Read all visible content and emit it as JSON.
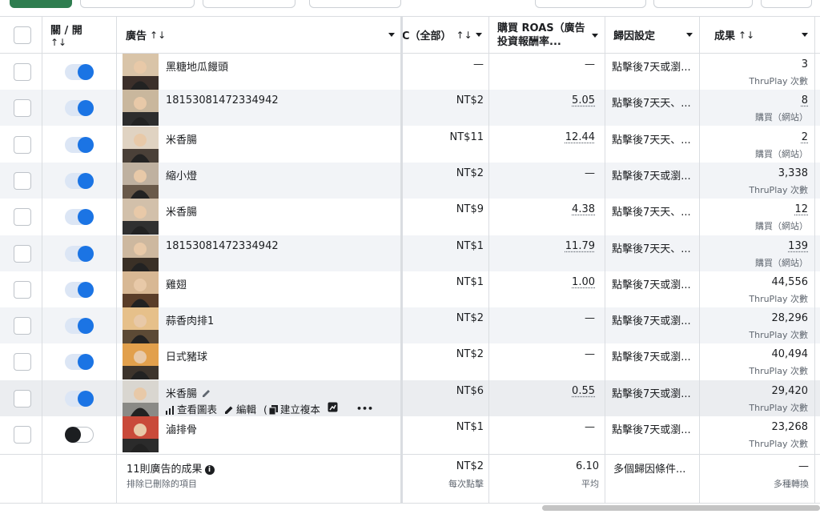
{
  "columns": {
    "toggle": "關 / 開",
    "ad": "廣告",
    "cpc": "C（全部）",
    "roas": "購買 ROAS（廣告投資報酬率...",
    "attribution": "歸因設定",
    "results": "成果",
    "sort_icon": "↑↓"
  },
  "rows": [
    {
      "name": "黑糖地瓜饅頭",
      "on": true,
      "cpc": "—",
      "roas": "—",
      "attr": "點擊後7天或瀏...",
      "result": "3",
      "result_type": "ThruPlay 次數",
      "roas_link": false,
      "result_link": false
    },
    {
      "name": "18153081472334942",
      "on": true,
      "cpc": "NT$2",
      "roas": "5.05",
      "attr": "點擊後7天天、...",
      "result": "8",
      "result_type": "購買（網站）",
      "roas_link": true,
      "result_link": true
    },
    {
      "name": "米香腸",
      "on": true,
      "cpc": "NT$11",
      "roas": "12.44",
      "attr": "點擊後7天天、...",
      "result": "2",
      "result_type": "購買（網站）",
      "roas_link": true,
      "result_link": true
    },
    {
      "name": "縮小燈",
      "on": true,
      "cpc": "NT$2",
      "roas": "—",
      "attr": "點擊後7天或瀏...",
      "result": "3,338",
      "result_type": "ThruPlay 次數",
      "roas_link": false,
      "result_link": false
    },
    {
      "name": "米香腸",
      "on": true,
      "cpc": "NT$9",
      "roas": "4.38",
      "attr": "點擊後7天天、...",
      "result": "12",
      "result_type": "購買（網站）",
      "roas_link": true,
      "result_link": true
    },
    {
      "name": "18153081472334942",
      "on": true,
      "cpc": "NT$1",
      "roas": "11.79",
      "attr": "點擊後7天天、...",
      "result": "139",
      "result_type": "購買（網站）",
      "roas_link": true,
      "result_link": true
    },
    {
      "name": "雞翅",
      "on": true,
      "cpc": "NT$1",
      "roas": "1.00",
      "attr": "點擊後7天或瀏...",
      "result": "44,556",
      "result_type": "ThruPlay 次數",
      "roas_link": true,
      "result_link": false
    },
    {
      "name": "蒜香肉排1",
      "on": true,
      "cpc": "NT$2",
      "roas": "—",
      "attr": "點擊後7天或瀏...",
      "result": "28,296",
      "result_type": "ThruPlay 次數",
      "roas_link": false,
      "result_link": false
    },
    {
      "name": "日式豬球",
      "on": true,
      "cpc": "NT$2",
      "roas": "—",
      "attr": "點擊後7天或瀏...",
      "result": "40,494",
      "result_type": "ThruPlay 次數",
      "roas_link": false,
      "result_link": false
    },
    {
      "name": "米香腸",
      "on": true,
      "cpc": "NT$6",
      "roas": "0.55",
      "attr": "點擊後7天或瀏...",
      "result": "29,420",
      "result_type": "ThruPlay 次數",
      "roas_link": true,
      "result_link": false
    },
    {
      "name": "滷排骨",
      "on": false,
      "cpc": "NT$1",
      "roas": "—",
      "attr": "點擊後7天或瀏...",
      "result": "23,268",
      "result_type": "ThruPlay 次數",
      "roas_link": false,
      "result_link": false
    }
  ],
  "hover_actions": {
    "chart": "查看圖表",
    "edit": "編輯",
    "duplicate": "建立複本",
    "more": "•••"
  },
  "summary": {
    "title": "11則廣告的成果",
    "subtitle": "排除已刪除的項目",
    "cpc": "NT$2",
    "cpc_sub": "每次點擊",
    "roas": "6.10",
    "roas_sub": "平均",
    "attr": "多個歸因條件...",
    "result": "—",
    "result_sub": "多種轉換"
  }
}
